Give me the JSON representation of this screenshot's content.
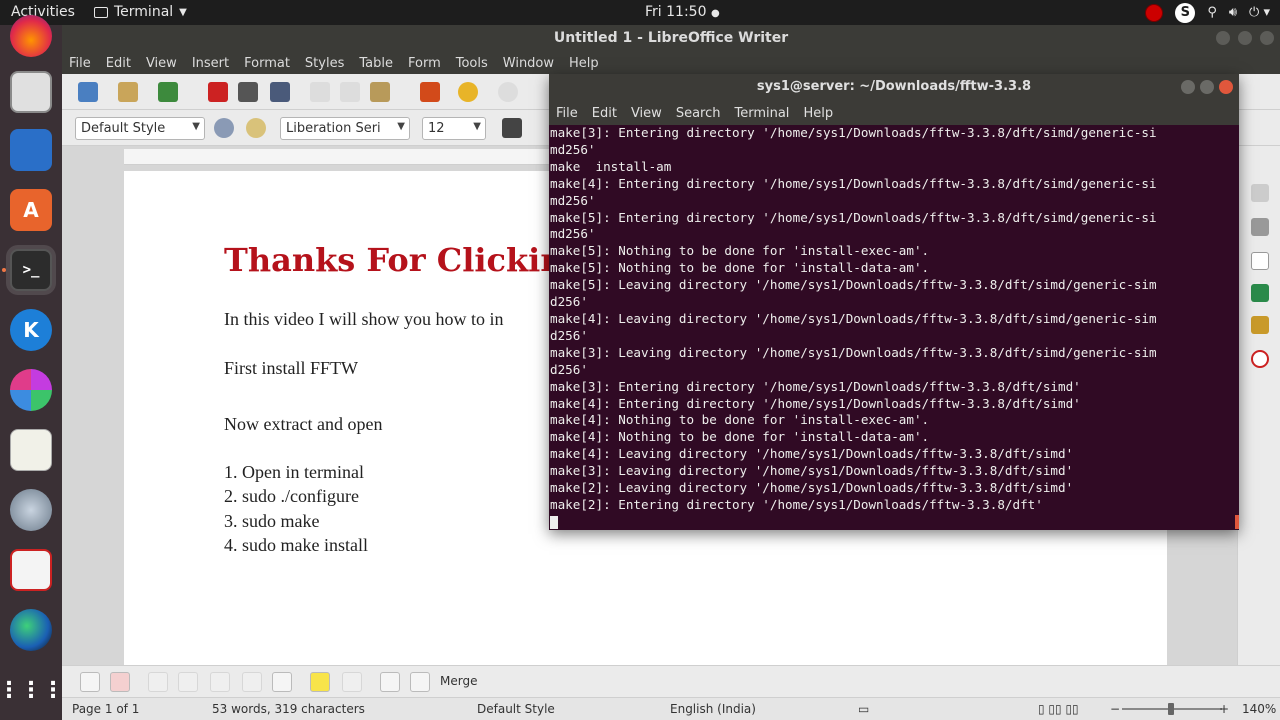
{
  "topbar": {
    "activities": "Activities",
    "app_name": "Terminal",
    "clock": "Fri 11:50",
    "tray_icons": [
      "record-icon",
      "skype-icon",
      "accessibility-icon",
      "volume-icon",
      "power-icon"
    ],
    "skype_letter": "S"
  },
  "dock": {
    "items": [
      "firefox-icon",
      "files-icon",
      "writer-icon",
      "software-center-icon",
      "terminal-icon",
      "kde-icon",
      "ms-office-icon",
      "text-editor-icon",
      "search-tool-icon",
      "pdf-reader-icon",
      "globe-icon",
      "show-apps-icon"
    ]
  },
  "writer": {
    "title": "Untitled 1 - LibreOffice Writer",
    "menu": [
      "File",
      "Edit",
      "View",
      "Insert",
      "Format",
      "Styles",
      "Table",
      "Form",
      "Tools",
      "Window",
      "Help"
    ],
    "paragraph_style": "Default Style",
    "font_name": "Liberation Seri",
    "font_size": "12",
    "document": {
      "heading": "Thanks For Clickin",
      "lines": [
        "In this video I will show you how to in",
        "First install FFTW",
        "Now extract and open",
        "1. Open in terminal",
        "2. sudo ./configure",
        "3. sudo make",
        "4. sudo make install"
      ]
    },
    "bottom_toolbar": {
      "merge_label": "Merge"
    },
    "status": {
      "page": "Page 1 of 1",
      "words": "53 words, 319 characters",
      "style": "Default Style",
      "language": "English (India)",
      "zoom": "140%"
    },
    "heading_color": "#b5121b"
  },
  "terminal": {
    "title": "sys1@server: ~/Downloads/fftw-3.3.8",
    "menu": [
      "File",
      "Edit",
      "View",
      "Search",
      "Terminal",
      "Help"
    ],
    "lines": [
      "make[3]: Entering directory '/home/sys1/Downloads/fftw-3.3.8/dft/simd/generic-si",
      "md256'",
      "make  install-am",
      "make[4]: Entering directory '/home/sys1/Downloads/fftw-3.3.8/dft/simd/generic-si",
      "md256'",
      "make[5]: Entering directory '/home/sys1/Downloads/fftw-3.3.8/dft/simd/generic-si",
      "md256'",
      "make[5]: Nothing to be done for 'install-exec-am'.",
      "make[5]: Nothing to be done for 'install-data-am'.",
      "make[5]: Leaving directory '/home/sys1/Downloads/fftw-3.3.8/dft/simd/generic-sim",
      "d256'",
      "make[4]: Leaving directory '/home/sys1/Downloads/fftw-3.3.8/dft/simd/generic-sim",
      "d256'",
      "make[3]: Leaving directory '/home/sys1/Downloads/fftw-3.3.8/dft/simd/generic-sim",
      "d256'",
      "make[3]: Entering directory '/home/sys1/Downloads/fftw-3.3.8/dft/simd'",
      "make[4]: Entering directory '/home/sys1/Downloads/fftw-3.3.8/dft/simd'",
      "make[4]: Nothing to be done for 'install-exec-am'.",
      "make[4]: Nothing to be done for 'install-data-am'.",
      "make[4]: Leaving directory '/home/sys1/Downloads/fftw-3.3.8/dft/simd'",
      "make[3]: Leaving directory '/home/sys1/Downloads/fftw-3.3.8/dft/simd'",
      "make[2]: Leaving directory '/home/sys1/Downloads/fftw-3.3.8/dft/simd'",
      "make[2]: Entering directory '/home/sys1/Downloads/fftw-3.3.8/dft'"
    ],
    "background_color": "#300a24"
  }
}
